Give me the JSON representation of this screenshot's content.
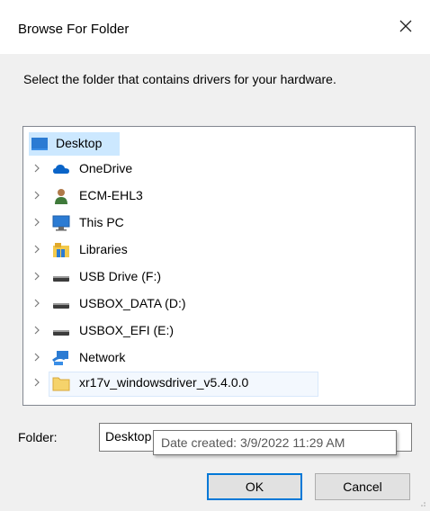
{
  "dialog": {
    "title": "Browse For Folder",
    "instruction": "Select the folder that contains drivers for your hardware."
  },
  "tree": {
    "items": [
      {
        "label": "Desktop",
        "icon": "desktop-icon",
        "selected": true
      },
      {
        "label": "OneDrive",
        "icon": "cloud-icon"
      },
      {
        "label": "ECM-EHL3",
        "icon": "user-icon"
      },
      {
        "label": "This PC",
        "icon": "computer-icon"
      },
      {
        "label": "Libraries",
        "icon": "libraries-icon"
      },
      {
        "label": "USB Drive (F:)",
        "icon": "drive-icon"
      },
      {
        "label": "USBOX_DATA (D:)",
        "icon": "drive-icon"
      },
      {
        "label": "USBOX_EFI (E:)",
        "icon": "drive-icon"
      },
      {
        "label": "Network",
        "icon": "network-icon"
      },
      {
        "label": "xr17v_windowsdriver_v5.4.0.0",
        "icon": "folder-icon",
        "hover": true
      }
    ]
  },
  "folder": {
    "label": "Folder:",
    "value": "Desktop"
  },
  "tooltip": {
    "text": "Date created: 3/9/2022 11:29 AM"
  },
  "buttons": {
    "ok": "OK",
    "cancel": "Cancel"
  },
  "colors": {
    "selection": "#cce8ff",
    "accent": "#0078d7"
  }
}
